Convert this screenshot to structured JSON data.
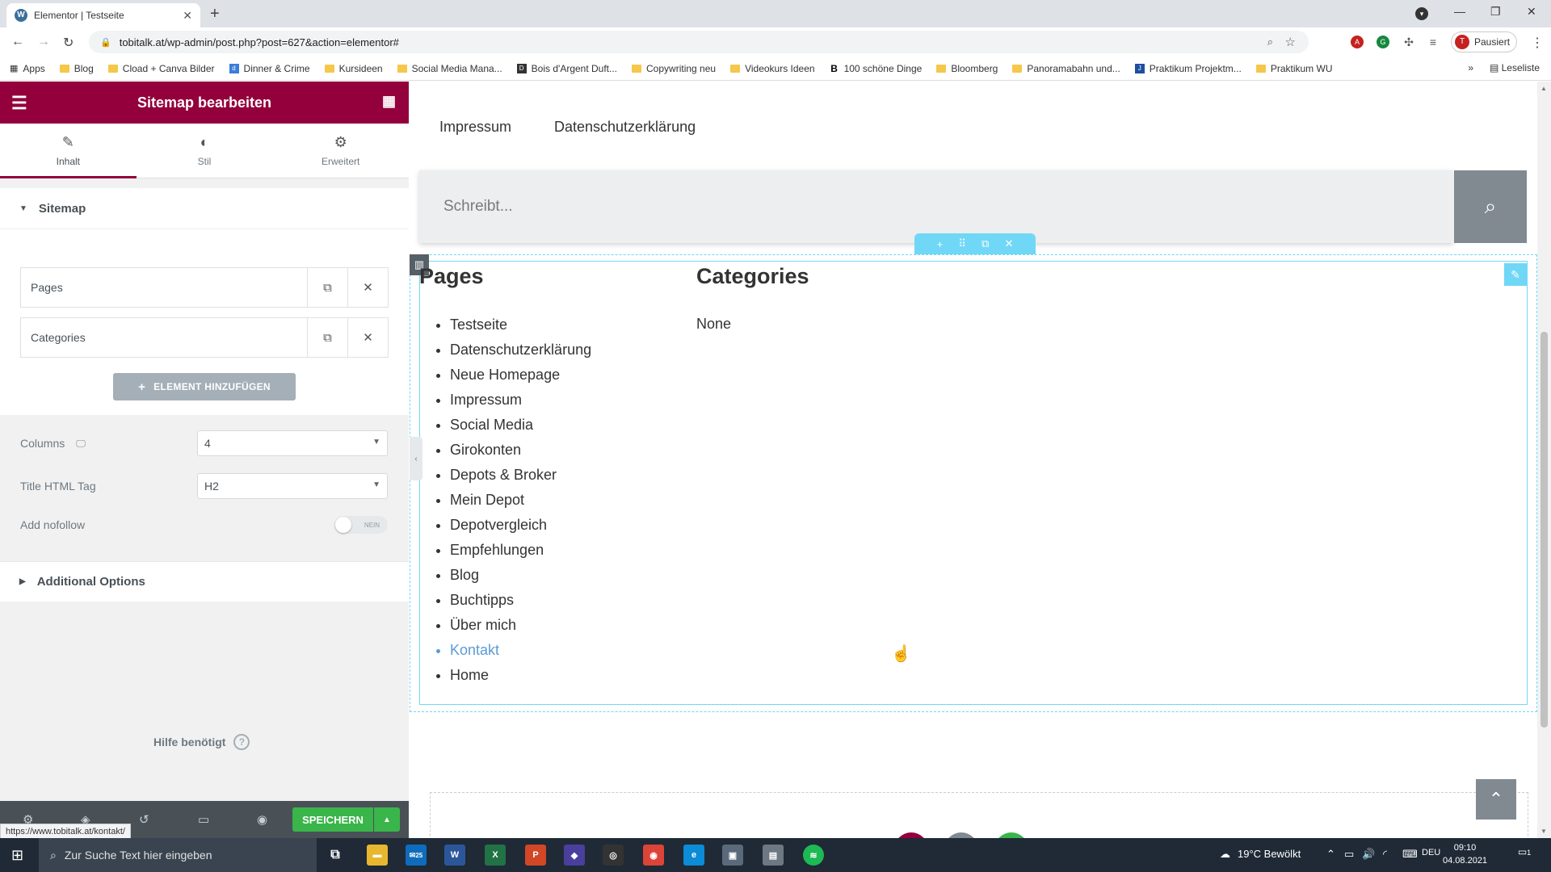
{
  "browser": {
    "tab_title": "Elementor | Testseite",
    "tab_icon_letter": "W",
    "url": "tobitalk.at/wp-admin/post.php?post=627&action=elementor#",
    "profile_status": "Pausiert",
    "profile_initial": "T",
    "reading_list": "Leseliste",
    "bookmarks": [
      {
        "label": "Apps",
        "kind": "apps-grid"
      },
      {
        "label": "Blog",
        "kind": "folder"
      },
      {
        "label": "Cload + Canva Bilder",
        "kind": "folder"
      },
      {
        "label": "Dinner & Crime",
        "kind": "site"
      },
      {
        "label": "Kursideen",
        "kind": "folder"
      },
      {
        "label": "Social Media Mana...",
        "kind": "folder"
      },
      {
        "label": "Bois d'Argent Duft...",
        "kind": "site"
      },
      {
        "label": "Copywriting neu",
        "kind": "folder"
      },
      {
        "label": "Videokurs Ideen",
        "kind": "folder"
      },
      {
        "label": "100 schöne Dinge",
        "kind": "site"
      },
      {
        "label": "Bloomberg",
        "kind": "folder"
      },
      {
        "label": "Panoramabahn und...",
        "kind": "folder"
      },
      {
        "label": "Praktikum Projektm...",
        "kind": "site"
      },
      {
        "label": "Praktikum WU",
        "kind": "folder"
      }
    ],
    "status_url": "https://www.tobitalk.at/kontakt/"
  },
  "panel": {
    "title": "Sitemap bearbeiten",
    "tabs": [
      {
        "label": "Inhalt",
        "icon": "pencil-icon"
      },
      {
        "label": "Stil",
        "icon": "contrast-icon"
      },
      {
        "label": "Erweitert",
        "icon": "gear-icon"
      }
    ],
    "sitemap_section": "Sitemap",
    "items": [
      "Pages",
      "Categories"
    ],
    "add_button": "ELEMENT HINZUFÜGEN",
    "columns_label": "Columns",
    "columns_value": "4",
    "title_tag_label": "Title HTML Tag",
    "title_tag_value": "H2",
    "nofollow_label": "Add nofollow",
    "nofollow_toggle": "NEIN",
    "additional_options": "Additional Options",
    "help": "Hilfe benötigt",
    "save": "SPEICHERN"
  },
  "canvas": {
    "nav_links": [
      "Impressum",
      "Datenschutzerklärung"
    ],
    "search_placeholder": "Schreibt...",
    "pages_title": "Pages",
    "categories_title": "Categories",
    "pages": [
      "Testseite",
      "Datenschutzerklärung",
      "Neue Homepage",
      "Impressum",
      "Social Media",
      "Girokonten",
      "Depots & Broker",
      "Mein Depot",
      "Depotvergleich",
      "Empfehlungen",
      "Blog",
      "Buchtipps",
      "Über mich",
      "Kontakt",
      "Home"
    ],
    "hovered_page": "Kontakt",
    "categories_empty": "None"
  },
  "taskbar": {
    "search_placeholder": "Zur Suche Text hier eingeben",
    "weather": "19°C  Bewölkt",
    "language": "DEU",
    "time": "09:10",
    "date": "04.08.2021",
    "mail_badge": "25",
    "notification_count": "1"
  },
  "colors": {
    "elementor_brand": "#93003c",
    "save_green": "#39b54a",
    "edit_handle": "#71d7f7",
    "link_blue": "#5b9bd5"
  }
}
